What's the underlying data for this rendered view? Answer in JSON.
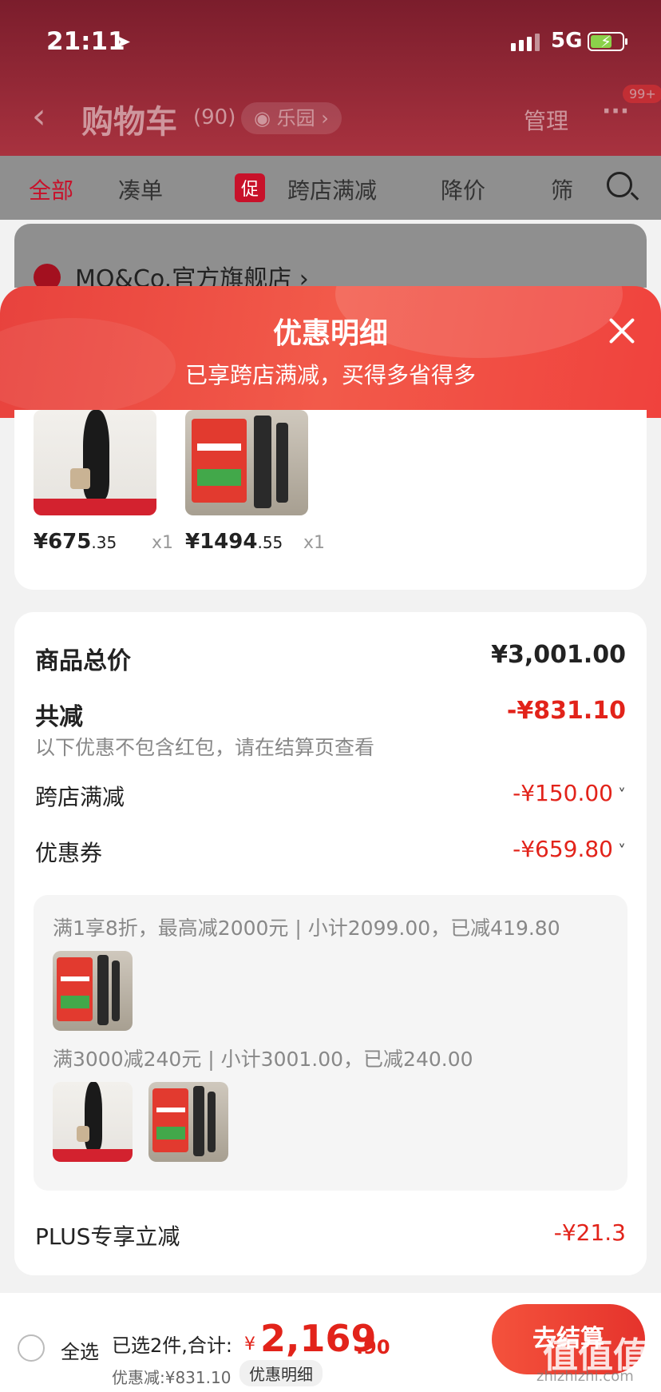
{
  "status_bar": {
    "time": "21:11",
    "network": "5G"
  },
  "nav": {
    "title": "购物车",
    "count": "(90)",
    "pill": "◉ 乐园 ›",
    "manage": "管理",
    "more": "···",
    "badge": "99+"
  },
  "tabs": {
    "all": "全部",
    "combine": "凑单",
    "promo_badge": "促",
    "promo": "跨店满减",
    "price_drop": "降价",
    "filter": "筛"
  },
  "store": {
    "name": "MO&Co.官方旗舰店 ›"
  },
  "sheet": {
    "title": "优惠明细",
    "subtitle": "已享跨店满减，买得多省得多"
  },
  "products": [
    {
      "price_int": "¥675",
      "price_dec": ".35",
      "qty": "x1"
    },
    {
      "price_int": "¥1494",
      "price_dec": ".55",
      "qty": "x1"
    }
  ],
  "detail": {
    "total_label": "商品总价",
    "total_value": "¥3,001.00",
    "reduce_label": "共减",
    "reduce_value": "-¥831.10",
    "note": "以下优惠不包含红包，请在结算页查看",
    "cross_label": "跨店满减",
    "cross_value": "-¥150.00",
    "coupon_label": "优惠券",
    "coupon_value": "-¥659.80",
    "coupon_line1": "满1享8折，最高减2000元 | 小计2099.00，已减419.80",
    "coupon_line2": "满3000减240元 | 小计3001.00，已减240.00",
    "plus_label": "PLUS专享立减",
    "plus_value": "-¥21.3"
  },
  "bottom": {
    "select_all": "全选",
    "selected": "已选2件,合计:",
    "currency": "¥",
    "total_int": "2,169",
    "total_dec": ".90",
    "discount": "优惠减:¥831.10",
    "detail_link": "优惠明细",
    "checkout": "去结算"
  },
  "watermark": {
    "main": "值值值",
    "sub": "zhizhizhi.com"
  },
  "colors": {
    "accent_red": "#e2231a",
    "header_red": "#f0423d",
    "nav_bg": "#7b1d2c"
  }
}
